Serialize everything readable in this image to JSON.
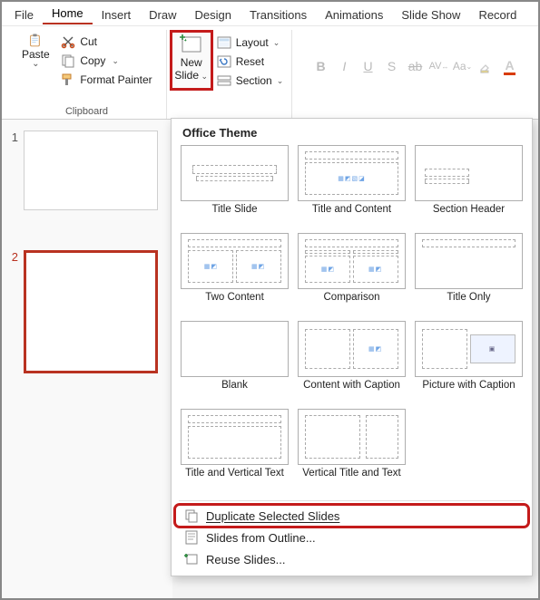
{
  "tabs": [
    "File",
    "Home",
    "Insert",
    "Draw",
    "Design",
    "Transitions",
    "Animations",
    "Slide Show",
    "Record"
  ],
  "active_tab_index": 1,
  "clipboard": {
    "paste_label": "Paste",
    "cut_label": "Cut",
    "copy_label": "Copy",
    "format_painter_label": "Format Painter",
    "group_label": "Clipboard"
  },
  "slides_group": {
    "new_slide_line1": "New",
    "new_slide_line2": "Slide",
    "layout_label": "Layout",
    "reset_label": "Reset",
    "section_label": "Section"
  },
  "thumbnails": {
    "items": [
      {
        "number": "1",
        "selected": false
      },
      {
        "number": "2",
        "selected": true
      }
    ]
  },
  "dropdown": {
    "header": "Office Theme",
    "layouts": [
      "Title Slide",
      "Title and Content",
      "Section Header",
      "Two Content",
      "Comparison",
      "Title Only",
      "Blank",
      "Content with Caption",
      "Picture with Caption",
      "Title and Vertical Text",
      "Vertical Title and Text"
    ],
    "menu": {
      "duplicate": "Duplicate Selected Slides",
      "outline": "Slides from Outline...",
      "reuse": "Reuse Slides..."
    }
  }
}
